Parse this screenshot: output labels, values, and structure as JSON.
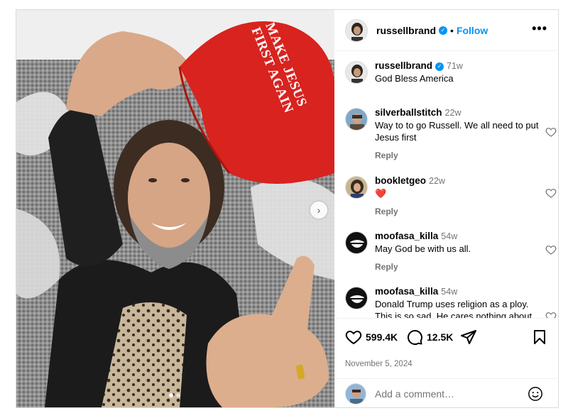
{
  "post": {
    "author": "russellbrand",
    "follow_label": "Follow",
    "more_label": "•••",
    "photo": {
      "hat_text_line1": "MAKE JESUS",
      "hat_text_line2": "FIRST AGAIN",
      "next_label": "›",
      "carousel_total": 2,
      "carousel_active": 1
    },
    "caption": {
      "name": "russellbrand",
      "time": "71w",
      "text": "God Bless America"
    },
    "comments": [
      {
        "name": "silverballstitch",
        "time": "22w",
        "text": "Way to to go Russell. We all need to put Jesus first",
        "reply_label": "Reply"
      },
      {
        "name": "bookletgeo",
        "time": "22w",
        "text": "❤️",
        "reply_label": "Reply"
      },
      {
        "name": "moofasa_killa",
        "time": "54w",
        "text": "May God be with us all.",
        "reply_label": "Reply"
      },
      {
        "name": "moofasa_killa",
        "time": "54w",
        "text": "Donald Trump uses religion as a ploy. This is so sad. He cares nothing about us or Jesus. The Word",
        "reply_label": ""
      }
    ],
    "likes": "599.4K",
    "comment_count": "12.5K",
    "date": "November 5, 2024",
    "add_comment_placeholder": "Add a comment…"
  },
  "colors": {
    "accent": "#0095f6",
    "secondary_text": "#737373",
    "hat_red": "#d8231f"
  },
  "icons": [
    "verified-badge-icon",
    "more-options-icon",
    "heart-icon",
    "comment-icon",
    "share-icon",
    "bookmark-icon",
    "emoji-icon",
    "chevron-right-icon"
  ]
}
